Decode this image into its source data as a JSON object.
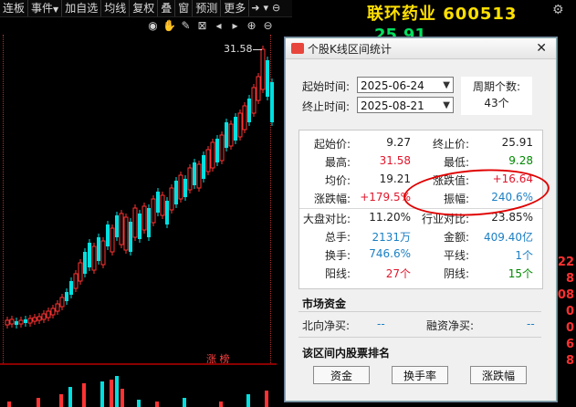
{
  "toolbar": {
    "items": [
      "连板",
      "事件",
      "加自选",
      "均线",
      "复权",
      "叠",
      "窗",
      "预测",
      "更多"
    ],
    "arrow": "▼"
  },
  "stock": {
    "title": "联环药业 600513",
    "price": "25.91"
  },
  "chart": {
    "high_label": "31.58",
    "zb_label": "涨 榜"
  },
  "right_values": [
    "22",
    "8",
    "08",
    "0",
    "0",
    "6",
    "8"
  ],
  "dialog": {
    "title": "个股K线区间统计",
    "start_label": "起始时间:",
    "start_value": "2025-06-24",
    "end_label": "终止时间:",
    "end_value": "2025-08-21",
    "period_label": "周期个数:",
    "period_value": "43个",
    "stats": [
      {
        "k1": "起始价:",
        "v1": "9.27",
        "c1": "black",
        "k2": "终止价:",
        "v2": "25.91",
        "c2": "black"
      },
      {
        "k1": "最高:",
        "v1": "31.58",
        "c1": "red",
        "k2": "最低:",
        "v2": "9.28",
        "c2": "green"
      },
      {
        "k1": "均价:",
        "v1": "19.21",
        "c1": "black",
        "k2": "涨跌值:",
        "v2": "+16.64",
        "c2": "red"
      },
      {
        "k1": "涨跌幅:",
        "v1": "+179.5%",
        "c1": "red",
        "k2": "振幅:",
        "v2": "240.6%",
        "c2": "blue"
      },
      {
        "k1": "大盘对比:",
        "v1": "11.20%",
        "c1": "black",
        "k2": "行业对比:",
        "v2": "23.85%",
        "c2": "black"
      },
      {
        "k1": "总手:",
        "v1": "2131万",
        "c1": "blue",
        "k2": "金额:",
        "v2": "409.40亿",
        "c2": "blue"
      },
      {
        "k1": "换手:",
        "v1": "746.6%",
        "c1": "blue",
        "k2": "平线:",
        "v2": "1个",
        "c2": "blue"
      },
      {
        "k1": "阳线:",
        "v1": "27个",
        "c1": "red",
        "k2": "阴线:",
        "v2": "15个",
        "c2": "green"
      }
    ],
    "market_funds_title": "市场资金",
    "north_label": "北向净买:",
    "north_value": "--",
    "margin_label": "融资净买:",
    "margin_value": "--",
    "ranking_title": "该区间内股票排名",
    "buttons": [
      "资金",
      "换手率",
      "涨跌幅"
    ]
  }
}
